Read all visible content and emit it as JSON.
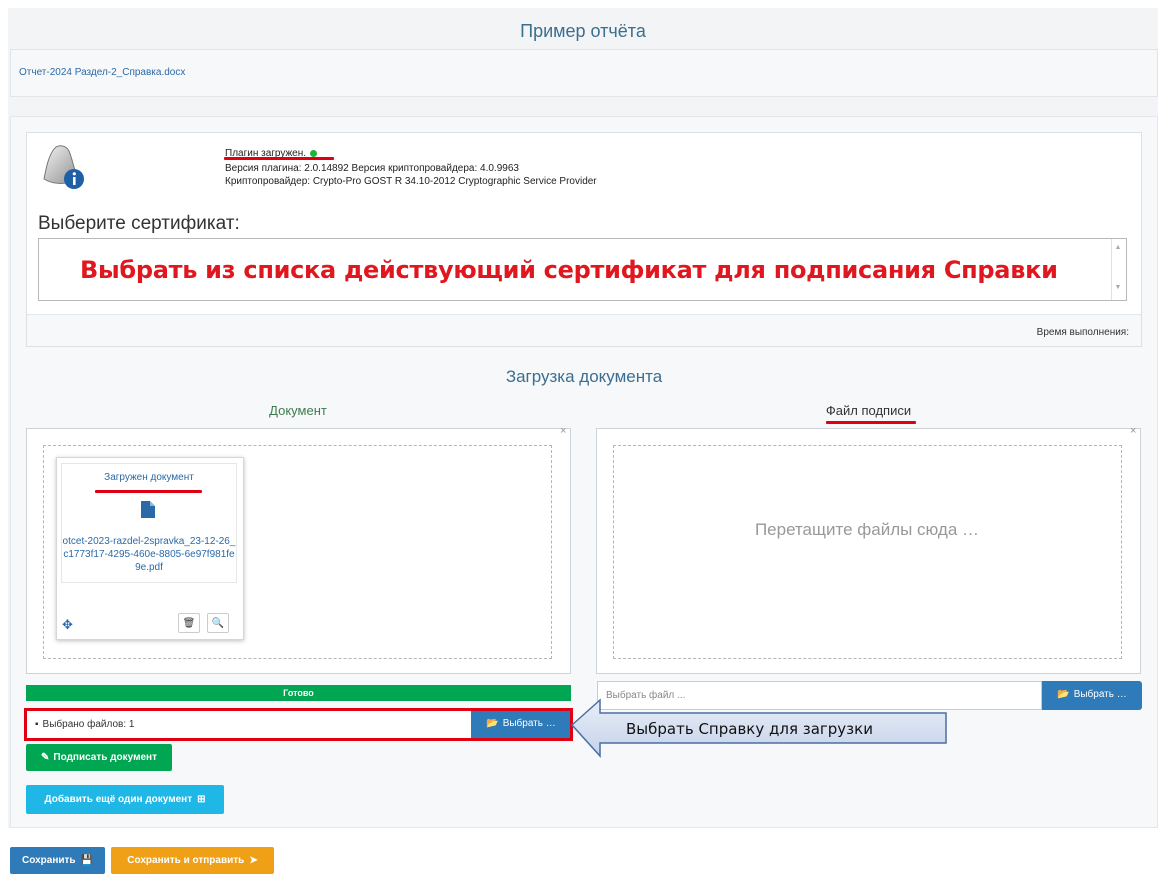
{
  "page": {
    "title": "Пример отчёта"
  },
  "report_file": {
    "link": "Отчет-2024 Раздел-2_Справка.docx"
  },
  "plugin": {
    "status": "Плагин загружен.",
    "version_line": "Версия плагина: 2.0.14892 Версия криптопровайдера: 4.0.9963",
    "provider_line": "Криптопровайдер: Crypto-Pro GOST R 34.10-2012 Cryptographic Service Provider",
    "status_color": "#1fb53b"
  },
  "certificate": {
    "label": "Выберите сертификат:",
    "annotation": "Выбрать из списка действующий сертификат для подписания Справки",
    "execution_time_label": "Время выполнения:"
  },
  "upload": {
    "heading": "Загрузка документа",
    "document_column": "Документ",
    "signature_column": "Файл подписи",
    "close_glyph": "×",
    "doc_card": {
      "title": "Загружен документ",
      "file_name": "otcet-2023-razdel-2spravka_23-12-26_c1773f17-4295-460e-8805-6e97f981fe9e.pdf",
      "move_icon": "move-icon",
      "delete_icon": "trash-icon",
      "zoom_icon": "zoom-in-icon"
    },
    "drop_hint": "Перетащите файлы сюда …",
    "progress_label": "Готово",
    "progress_value": 1.0,
    "left_input_value": "Выбрано файлов: 1",
    "right_input_placeholder": "Выбрать файл ...",
    "browse_label": "Выбрать …",
    "callout_text": "Выбрать  Справку для загрузки"
  },
  "actions": {
    "sign": "Подписать документ",
    "add_document": "Добавить ещё один документ",
    "save": "Сохранить",
    "save_send": "Сохранить и отправить"
  },
  "colors": {
    "accent_blue": "#2f7ab8",
    "success_green": "#00a651",
    "info_cyan": "#1eb7e6",
    "warning_orange": "#f0a017",
    "annotation_red": "#e00012"
  }
}
